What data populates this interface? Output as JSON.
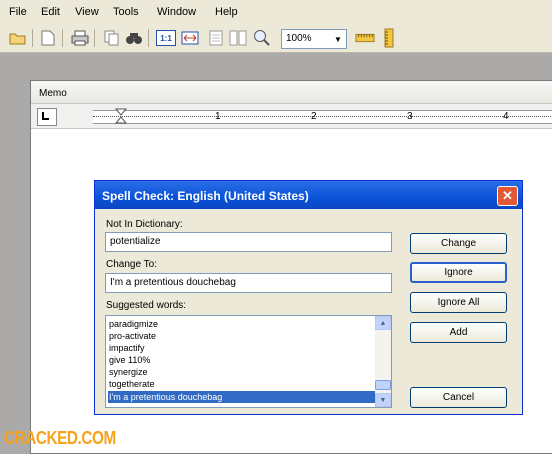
{
  "menu": {
    "items": [
      "File",
      "Edit",
      "View",
      "Tools",
      "Window",
      "Help"
    ]
  },
  "toolbar": {
    "icons": [
      "open-folder-icon",
      "new-document-icon",
      "print-icon",
      "copy-icon",
      "find-icon",
      "actual-size-icon",
      "fit-width-icon",
      "single-page-icon",
      "two-page-icon",
      "zoom-icon",
      "ruler-icon",
      "vertical-ruler-icon"
    ],
    "actual_size_label": "1:1",
    "zoom_value": "100%"
  },
  "memo": {
    "title": "Memo",
    "ruler_numbers": [
      "1",
      "2",
      "3",
      "4"
    ]
  },
  "dialog": {
    "title": "Spell Check: English (United States)",
    "not_in_dictionary_label": "Not In Dictionary:",
    "not_in_dictionary_value": "potentialize",
    "change_to_label": "Change To:",
    "change_to_value": "I'm a pretentious douchebag",
    "suggested_label": "Suggested words:",
    "suggestions": [
      "paradigmize",
      "pro-activate",
      "impactify",
      "give 110%",
      "synergize",
      "togetherate",
      "I'm a pretentious douchebag"
    ],
    "selected_suggestion": "I'm a pretentious douchebag",
    "buttons": {
      "change": "Change",
      "ignore": "Ignore",
      "ignore_all": "Ignore All",
      "add": "Add",
      "cancel": "Cancel"
    },
    "close_glyph": "✕"
  },
  "watermark": {
    "text": "CRACKED.COM"
  },
  "colors": {
    "titlebar": "#0a52d6",
    "selection": "#316ac5",
    "logo": "#f6a21c"
  }
}
